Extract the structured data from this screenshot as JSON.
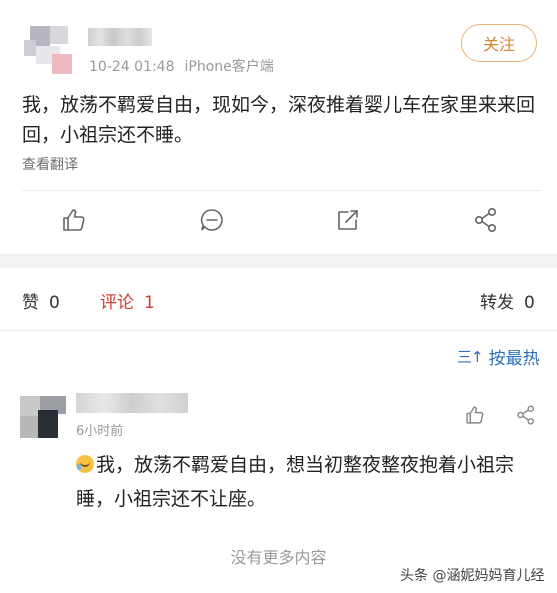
{
  "post": {
    "meta_time": "10-24 01:48",
    "meta_device": "iPhone客户端",
    "follow_label": "关注",
    "text": "我，放荡不羁爱自由，现如今，深夜推着婴儿车在家里来来回回，小祖宗还不睡。",
    "translate_label": "查看翻译",
    "actions": [
      "like-icon",
      "comment-icon",
      "forward-icon",
      "share-icon"
    ]
  },
  "stats": {
    "likes_label": "赞",
    "likes_count": "0",
    "comments_label": "评论",
    "comments_count": "1",
    "reposts_label": "转发",
    "reposts_count": "0"
  },
  "sort": {
    "icon": "三↑",
    "label": "按最热"
  },
  "comment": {
    "time": "6小时前",
    "emoji": "laugh-cry-emoji",
    "text": "我，放荡不羁爱自由，想当初整夜整夜抱着小祖宗睡，小祖宗还不让座。"
  },
  "footer": {
    "no_more": "没有更多内容",
    "watermark": "头条 @涵妮妈妈育儿经"
  },
  "colors": {
    "accent_orange": "#d2862f",
    "active_red": "#d33b34",
    "link_blue": "#2d6fbe"
  }
}
